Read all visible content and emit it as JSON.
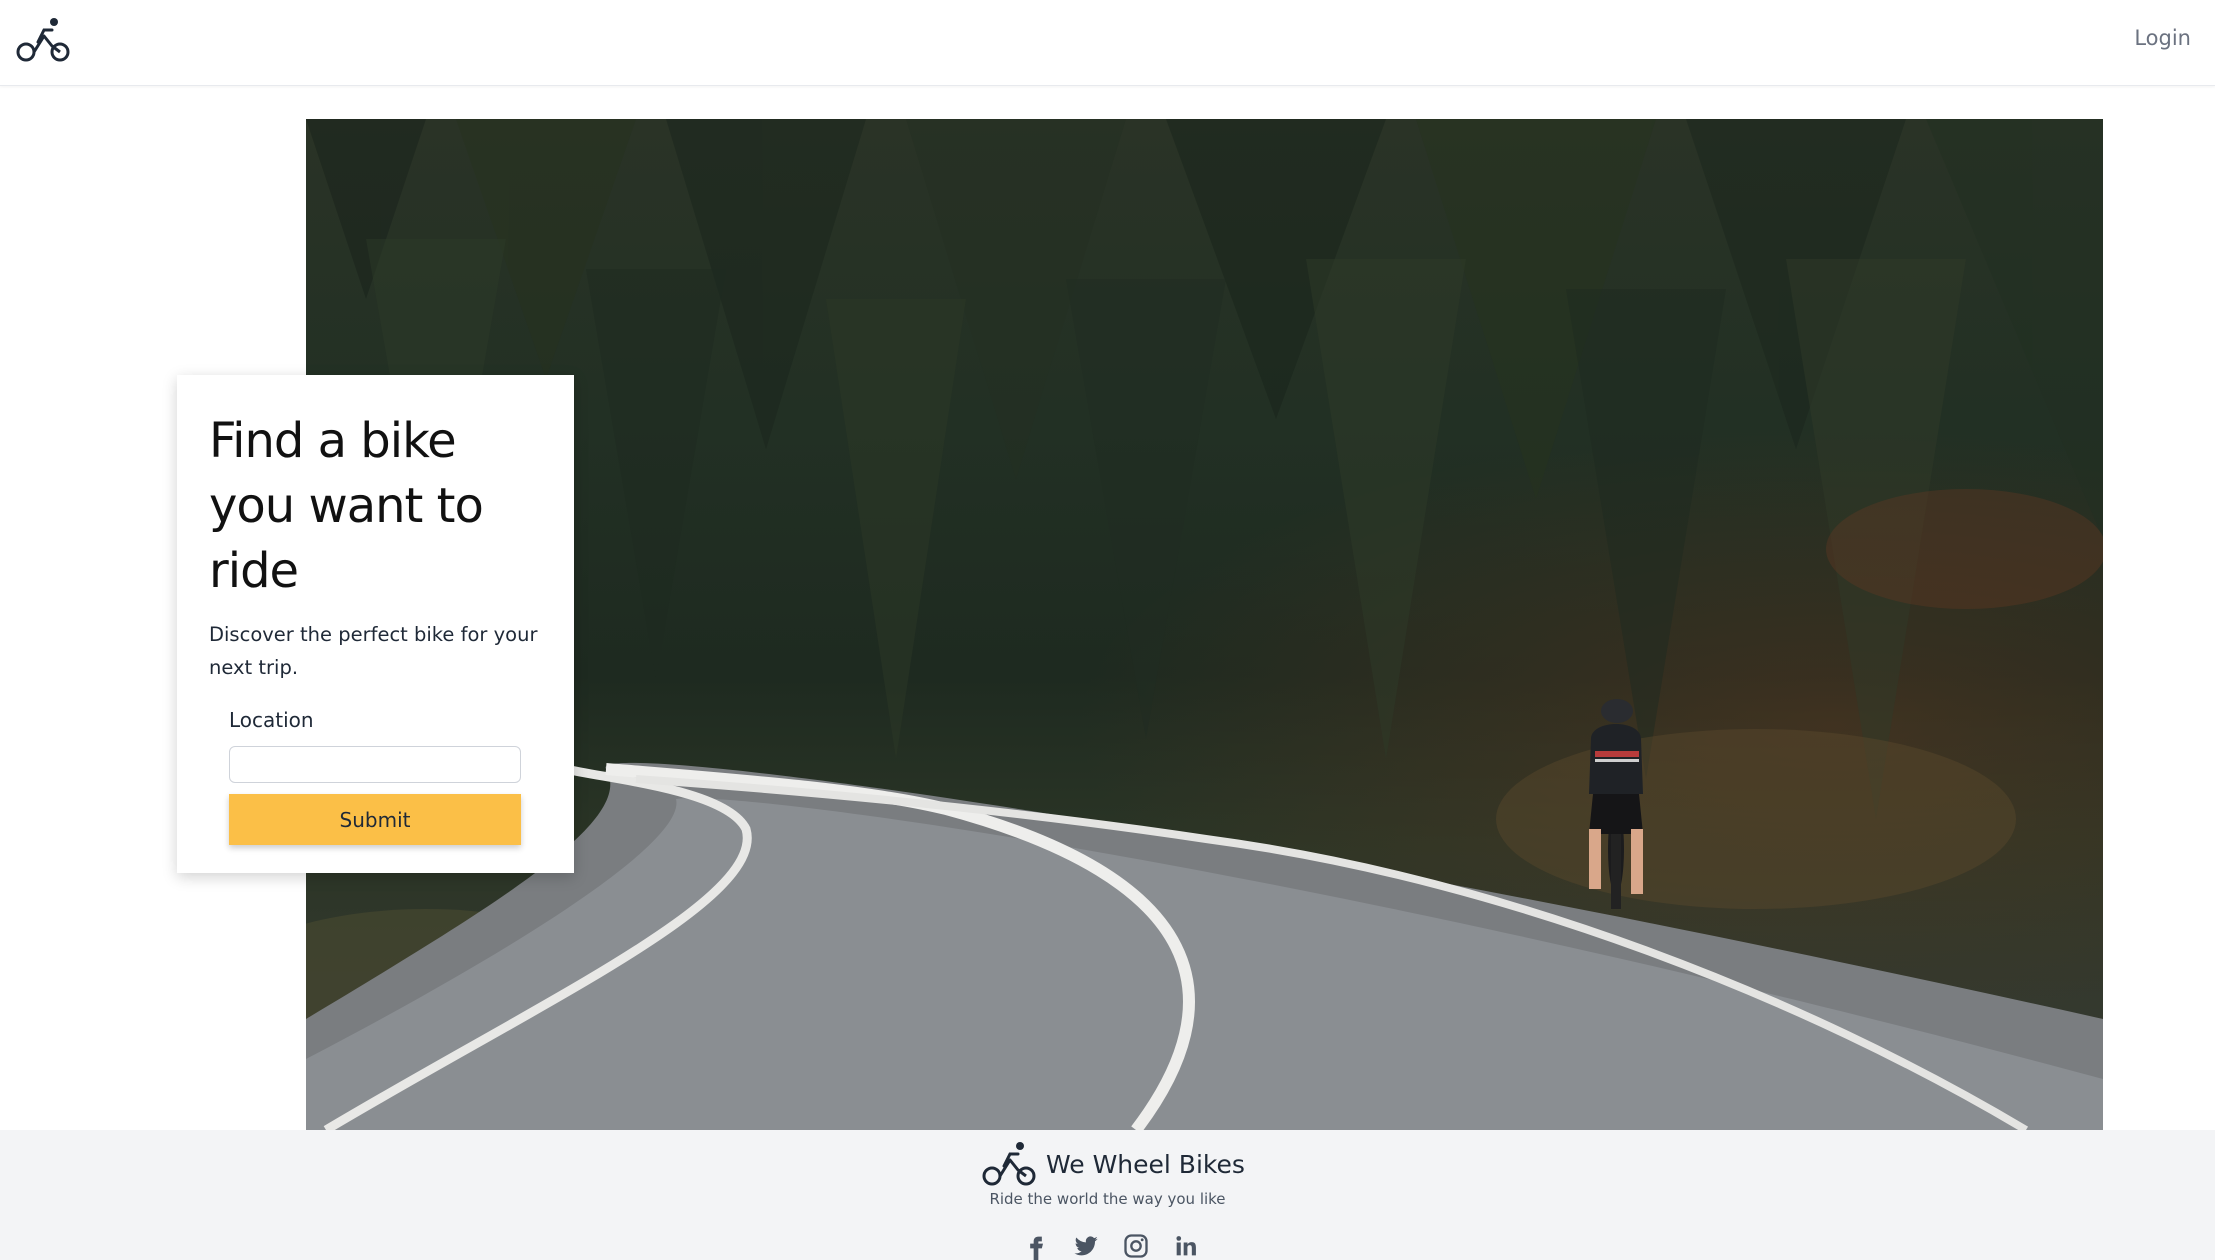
{
  "header": {
    "logo_icon": "bike-icon",
    "login_label": "Login"
  },
  "hero": {
    "image_subject": "cyclist-on-forest-road"
  },
  "card": {
    "title": "Find a bike you want to ride",
    "subtitle": "Discover the perfect bike for your next trip.",
    "location_label": "Location",
    "location_value": "",
    "submit_label": "Submit"
  },
  "footer": {
    "brand_name": "We Wheel Bikes",
    "tagline": "Ride the world the way you like",
    "socials": [
      "facebook-icon",
      "twitter-icon",
      "instagram-icon",
      "linkedin-icon"
    ]
  },
  "colors": {
    "accent": "#fbbf47",
    "footer_bg": "#f3f4f6",
    "text_muted": "#6b7280"
  }
}
